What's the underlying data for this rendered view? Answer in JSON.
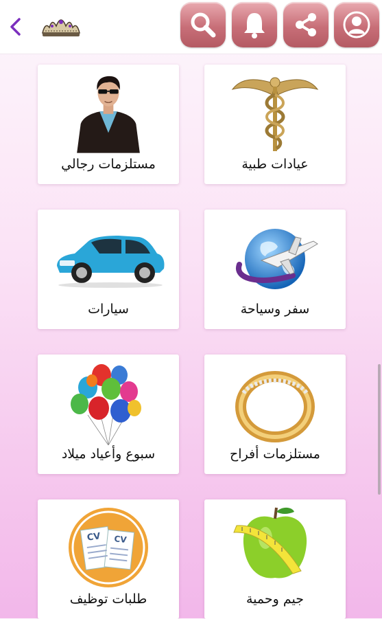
{
  "header": {
    "icons": [
      "back-chevron-icon",
      "crown-logo-icon",
      "search-icon",
      "bell-icon",
      "share-icon",
      "profile-icon"
    ],
    "accent_color": "#7b2fbe",
    "button_color": "#c86f78"
  },
  "categories": [
    {
      "label": "عيادات طبية",
      "icon": "caduceus-icon"
    },
    {
      "label": "مستلزمات رجالي",
      "icon": "man-icon"
    },
    {
      "label": "سفر وسياحة",
      "icon": "travel-globe-icon"
    },
    {
      "label": "سيارات",
      "icon": "car-icon"
    },
    {
      "label": "مستلزمات أفراح",
      "icon": "ring-icon"
    },
    {
      "label": "سبوع وأعياد ميلاد",
      "icon": "balloons-icon"
    },
    {
      "label": "جيم وحمية",
      "icon": "apple-tape-icon"
    },
    {
      "label": "طلبات توظيف",
      "icon": "cv-icon"
    }
  ],
  "cv_text": "CV"
}
